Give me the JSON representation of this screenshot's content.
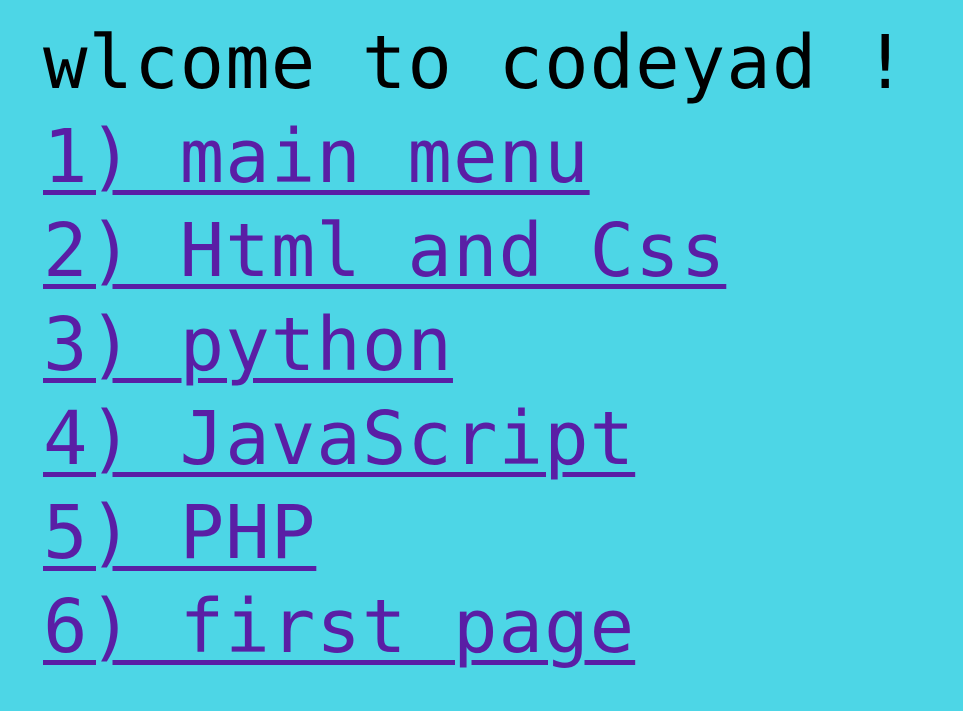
{
  "page": {
    "title": "wlcome to codeyad !"
  },
  "colors": {
    "background": "#4dd6e6",
    "link": "#5a1ea5",
    "text": "#000000"
  },
  "menu": {
    "items": [
      {
        "label": "1) main menu"
      },
      {
        "label": "2) Html and Css"
      },
      {
        "label": "3) python"
      },
      {
        "label": "4) JavaScript"
      },
      {
        "label": "5) PHP"
      },
      {
        "label": "6) first page"
      }
    ]
  }
}
